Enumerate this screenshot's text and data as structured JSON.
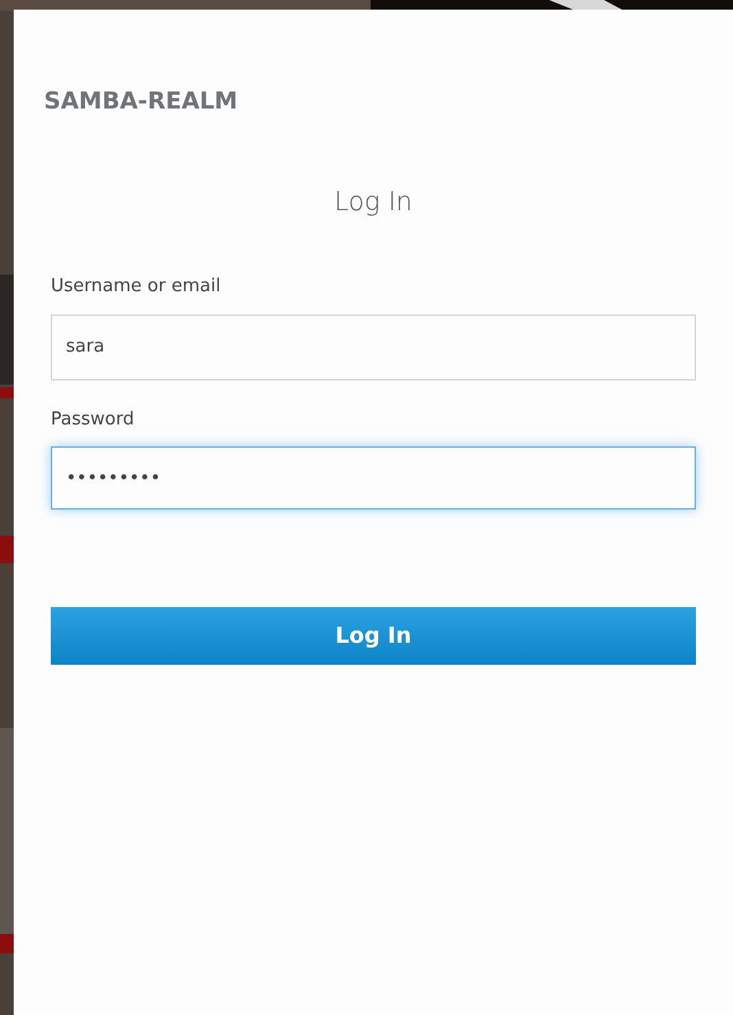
{
  "realm": "SAMBA-REALM",
  "heading": "Log In",
  "fields": [
    {
      "label": "Username or email",
      "value": "sara",
      "focused": false
    },
    {
      "label": "Password",
      "value": "•••••••••",
      "focused": true
    }
  ],
  "submit": "Log In"
}
